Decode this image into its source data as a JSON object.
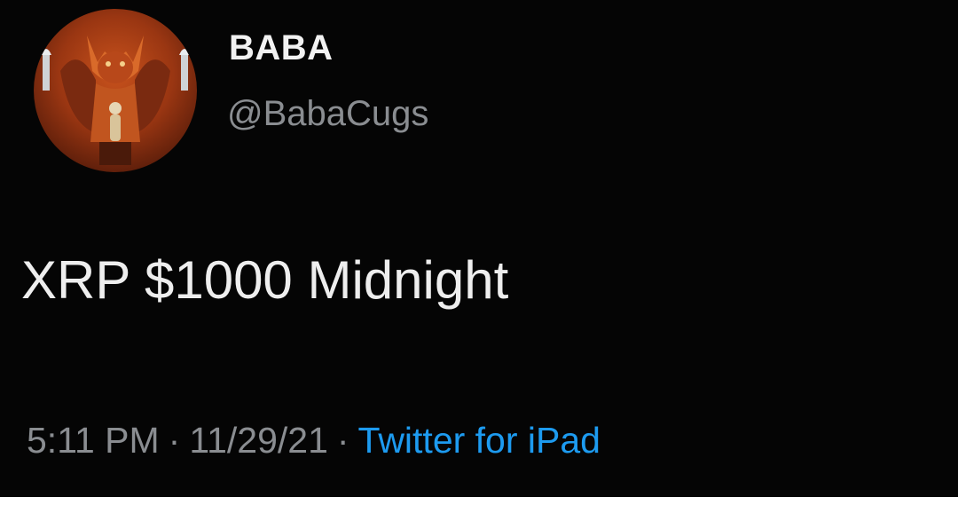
{
  "user": {
    "display_name": "BABA",
    "handle": "@BabaCugs",
    "avatar_icon": "demon-figure-avatar"
  },
  "tweet": {
    "text": "XRP $1000 Midnight"
  },
  "meta": {
    "time": "5:11 PM",
    "separator": "·",
    "date": "11/29/21",
    "source": "Twitter for iPad"
  },
  "colors": {
    "background": "#050505",
    "name": "#f2f2f2",
    "secondary": "#8a8d91",
    "link": "#1d9bf0"
  }
}
